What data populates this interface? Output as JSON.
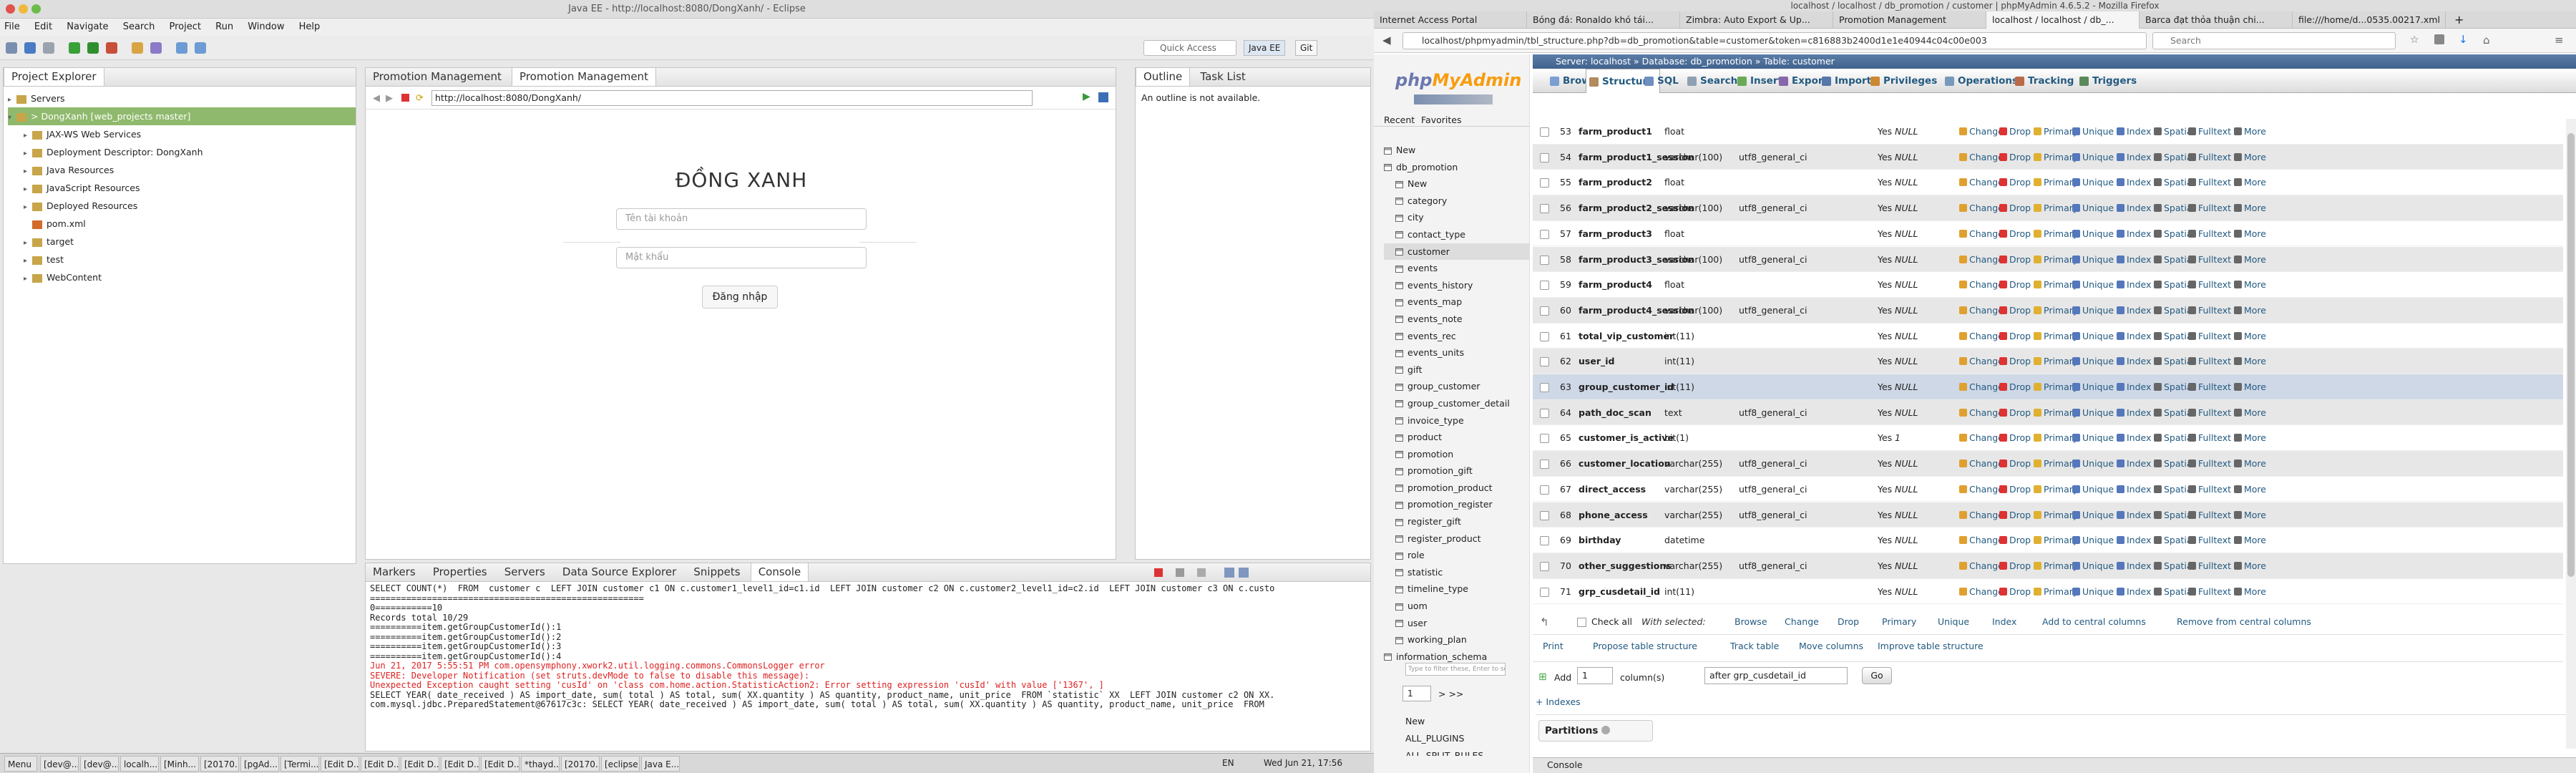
{
  "eclipse": {
    "title": "Java EE - http://localhost:8080/DongXanh/ - Eclipse",
    "menu": [
      "File",
      "Edit",
      "Navigate",
      "Search",
      "Project",
      "Run",
      "Window",
      "Help"
    ],
    "quick_access": "Quick Access",
    "perspectives": [
      "Java EE",
      "Git"
    ],
    "project_explorer": {
      "tab": "Project Explorer",
      "items": [
        {
          "label": "Servers",
          "depth": 0,
          "tw": "▸"
        },
        {
          "label": "> DongXanh [web_projects master]",
          "depth": 0,
          "tw": "▾",
          "selected": true
        },
        {
          "label": "JAX-WS Web Services",
          "depth": 1,
          "tw": "▸"
        },
        {
          "label": "Deployment Descriptor: DongXanh",
          "depth": 1,
          "tw": "▸"
        },
        {
          "label": "Java Resources",
          "depth": 1,
          "tw": "▸"
        },
        {
          "label": "JavaScript Resources",
          "depth": 1,
          "tw": "▸"
        },
        {
          "label": "Deployed Resources",
          "depth": 1,
          "tw": "▸"
        },
        {
          "label": "pom.xml",
          "depth": 1,
          "tw": ""
        },
        {
          "label": "target",
          "depth": 1,
          "tw": "▸"
        },
        {
          "label": "test",
          "depth": 1,
          "tw": "▸"
        },
        {
          "label": "WebContent",
          "depth": 1,
          "tw": "▸"
        }
      ]
    },
    "editor_tabs": [
      "Promotion Management",
      "Promotion Management"
    ],
    "browser_url": "http://localhost:8080/DongXanh/",
    "login": {
      "title": "ĐỒNG XANH",
      "username_placeholder": "Tên tài khoản",
      "password_placeholder": "Mật khẩu",
      "submit": "Đăng nhập"
    },
    "outline": {
      "tabs": [
        "Outline",
        "Task List"
      ],
      "message": "An outline is not available."
    },
    "bottom_tabs": [
      "Markers",
      "Properties",
      "Servers",
      "Data Source Explorer",
      "Snippets",
      "Console"
    ],
    "console_lines": [
      {
        "t": "SELECT COUNT(*)  FROM  customer c  LEFT JOIN customer c1 ON c.customer1_level1_id=c1.id  LEFT JOIN customer c2 ON c.customer2_level1_id=c2.id  LEFT JOIN customer c3 ON c.custo",
        "err": false
      },
      {
        "t": "=====================================================",
        "err": false
      },
      {
        "t": "0===========10",
        "err": false
      },
      {
        "t": "Records total 10/29",
        "err": false
      },
      {
        "t": "==========item.getGroupCustomerId():1",
        "err": false
      },
      {
        "t": "==========item.getGroupCustomerId():2",
        "err": false
      },
      {
        "t": "==========item.getGroupCustomerId():3",
        "err": false
      },
      {
        "t": "==========item.getGroupCustomerId():4",
        "err": false
      },
      {
        "t": "Jun 21, 2017 5:55:51 PM com.opensymphony.xwork2.util.logging.commons.CommonsLogger error",
        "err": true
      },
      {
        "t": "SEVERE: Developer Notification (set struts.devMode to false to disable this message):",
        "err": true
      },
      {
        "t": "Unexpected Exception caught setting 'cusId' on 'class com.home.action.StatisticAction2: Error setting expression 'cusId' with value ['1367', ]",
        "err": true
      },
      {
        "t": "SELECT YEAR( date_received ) AS import_date, sum( total ) AS total, sum( XX.quantity ) AS quantity, product_name, unit_price  FROM `statistic` XX  LEFT JOIN customer c2 ON XX.",
        "err": false
      },
      {
        "t": "com.mysql.jdbc.PreparedStatement@67617c3c: SELECT YEAR( date_received ) AS import_date, sum( total ) AS total, sum( XX.quantity ) AS quantity, product_name, unit_price  FROM",
        "err": false
      }
    ]
  },
  "taskbar": {
    "items": [
      "Menu",
      "[dev@...",
      "[dev@...",
      "localh...",
      "[Minh...",
      "[20170...",
      "[pgAd...",
      "[Termi...",
      "[Edit D...",
      "[Edit D...",
      "[Edit D...",
      "[Edit D...",
      "[Edit D...",
      "*thayd...",
      "[20170...",
      "[eclipse]",
      "Java E..."
    ],
    "clock": "Wed Jun 21, 17:56",
    "lang": "EN"
  },
  "firefox": {
    "title": "localhost / localhost / db_promotion / customer | phpMyAdmin 4.6.5.2 - Mozilla Firefox",
    "tabs": [
      "Internet Access Portal",
      "Bóng đá: Ronaldo khó tái...",
      "Zimbra: Auto Export & Up...",
      "Promotion Management",
      "localhost / localhost / db_...",
      "Barca đạt thỏa thuận chi...",
      "file:///home/d...0535.00217.xml"
    ],
    "url": "localhost/phpmyadmin/tbl_structure.php?db=db_promotion&table=customer&token=c816883b2400d1e1e40944c04c00e003",
    "search": "Search"
  },
  "pma": {
    "logo_a": "php",
    "logo_b": "MyAdmin",
    "recent": "Recent",
    "favorites": "Favorites",
    "tree": [
      {
        "label": "New",
        "depth": 0
      },
      {
        "label": "db_promotion",
        "depth": 0
      },
      {
        "label": "New",
        "depth": 1
      },
      {
        "label": "category",
        "depth": 1
      },
      {
        "label": "city",
        "depth": 1
      },
      {
        "label": "contact_type",
        "depth": 1
      },
      {
        "label": "customer",
        "depth": 1,
        "hl": true
      },
      {
        "label": "events",
        "depth": 1
      },
      {
        "label": "events_history",
        "depth": 1
      },
      {
        "label": "events_map",
        "depth": 1
      },
      {
        "label": "events_note",
        "depth": 1
      },
      {
        "label": "events_rec",
        "depth": 1
      },
      {
        "label": "events_units",
        "depth": 1
      },
      {
        "label": "gift",
        "depth": 1
      },
      {
        "label": "group_customer",
        "depth": 1
      },
      {
        "label": "group_customer_detail",
        "depth": 1
      },
      {
        "label": "invoice_type",
        "depth": 1
      },
      {
        "label": "product",
        "depth": 1
      },
      {
        "label": "promotion",
        "depth": 1
      },
      {
        "label": "promotion_gift",
        "depth": 1
      },
      {
        "label": "promotion_product",
        "depth": 1
      },
      {
        "label": "promotion_register",
        "depth": 1
      },
      {
        "label": "register_gift",
        "depth": 1
      },
      {
        "label": "register_product",
        "depth": 1
      },
      {
        "label": "role",
        "depth": 1
      },
      {
        "label": "statistic",
        "depth": 1
      },
      {
        "label": "timeline_type",
        "depth": 1
      },
      {
        "label": "uom",
        "depth": 1
      },
      {
        "label": "user",
        "depth": 1
      },
      {
        "label": "working_plan",
        "depth": 1
      },
      {
        "label": "information_schema",
        "depth": 0
      }
    ],
    "filter_placeholder": "Type to filter these, Enter to search all",
    "pager": {
      "page": "1",
      "next": "> >>"
    },
    "tree_bottom": [
      "New",
      "ALL_PLUGINS",
      "ALL_SPLIT_RULES"
    ],
    "breadcrumb": "Server: localhost » Database: db_promotion » Table: customer",
    "tabs": [
      "Browse",
      "Structure",
      "SQL",
      "Search",
      "Insert",
      "Export",
      "Import",
      "Privileges",
      "Operations",
      "Tracking",
      "Triggers"
    ],
    "columns": [
      {
        "n": "53",
        "name": "farm_product1",
        "type": "float",
        "coll": "",
        "null": "Yes",
        "def": "NULL"
      },
      {
        "n": "54",
        "name": "farm_product1_session",
        "type": "varchar(100)",
        "coll": "utf8_general_ci",
        "null": "Yes",
        "def": "NULL"
      },
      {
        "n": "55",
        "name": "farm_product2",
        "type": "float",
        "coll": "",
        "null": "Yes",
        "def": "NULL"
      },
      {
        "n": "56",
        "name": "farm_product2_session",
        "type": "varchar(100)",
        "coll": "utf8_general_ci",
        "null": "Yes",
        "def": "NULL"
      },
      {
        "n": "57",
        "name": "farm_product3",
        "type": "float",
        "coll": "",
        "null": "Yes",
        "def": "NULL"
      },
      {
        "n": "58",
        "name": "farm_product3_session",
        "type": "varchar(100)",
        "coll": "utf8_general_ci",
        "null": "Yes",
        "def": "NULL"
      },
      {
        "n": "59",
        "name": "farm_product4",
        "type": "float",
        "coll": "",
        "null": "Yes",
        "def": "NULL"
      },
      {
        "n": "60",
        "name": "farm_product4_session",
        "type": "varchar(100)",
        "coll": "utf8_general_ci",
        "null": "Yes",
        "def": "NULL"
      },
      {
        "n": "61",
        "name": "total_vip_customer",
        "type": "int(11)",
        "coll": "",
        "null": "Yes",
        "def": "NULL"
      },
      {
        "n": "62",
        "name": "user_id",
        "type": "int(11)",
        "coll": "",
        "null": "Yes",
        "def": "NULL"
      },
      {
        "n": "63",
        "name": "group_customer_id",
        "type": "int(11)",
        "coll": "",
        "null": "Yes",
        "def": "NULL"
      },
      {
        "n": "64",
        "name": "path_doc_scan",
        "type": "text",
        "coll": "utf8_general_ci",
        "null": "Yes",
        "def": "NULL"
      },
      {
        "n": "65",
        "name": "customer_is_active",
        "type": "bit(1)",
        "coll": "",
        "null": "Yes",
        "def": "1"
      },
      {
        "n": "66",
        "name": "customer_location",
        "type": "varchar(255)",
        "coll": "utf8_general_ci",
        "null": "Yes",
        "def": "NULL"
      },
      {
        "n": "67",
        "name": "direct_access",
        "type": "varchar(255)",
        "coll": "utf8_general_ci",
        "null": "Yes",
        "def": "NULL"
      },
      {
        "n": "68",
        "name": "phone_access",
        "type": "varchar(255)",
        "coll": "utf8_general_ci",
        "null": "Yes",
        "def": "NULL"
      },
      {
        "n": "69",
        "name": "birthday",
        "type": "datetime",
        "coll": "",
        "null": "Yes",
        "def": "NULL"
      },
      {
        "n": "70",
        "name": "other_suggestions",
        "type": "varchar(255)",
        "coll": "utf8_general_ci",
        "null": "Yes",
        "def": "NULL"
      },
      {
        "n": "71",
        "name": "grp_cusdetail_id",
        "type": "int(11)",
        "coll": "",
        "null": "Yes",
        "def": "NULL"
      }
    ],
    "row_actions": [
      "Change",
      "Drop",
      "Primary",
      "Unique",
      "Index",
      "Spatial",
      "Fulltext",
      "More"
    ],
    "check_all": "Check all",
    "with_selected": "With selected:",
    "bulk_actions": [
      "Browse",
      "Change",
      "Drop",
      "Primary",
      "Unique",
      "Index",
      "Add to central columns",
      "Remove from central columns"
    ],
    "tools": [
      "Print",
      "Propose table structure",
      "Track table",
      "Move columns",
      "Improve table structure"
    ],
    "add": {
      "label": "Add",
      "count": "1",
      "suffix": "column(s)",
      "position": "after grp_cusdetail_id",
      "go": "Go"
    },
    "indexes": "+ Indexes",
    "partitions": "Partitions",
    "console": "Console"
  }
}
